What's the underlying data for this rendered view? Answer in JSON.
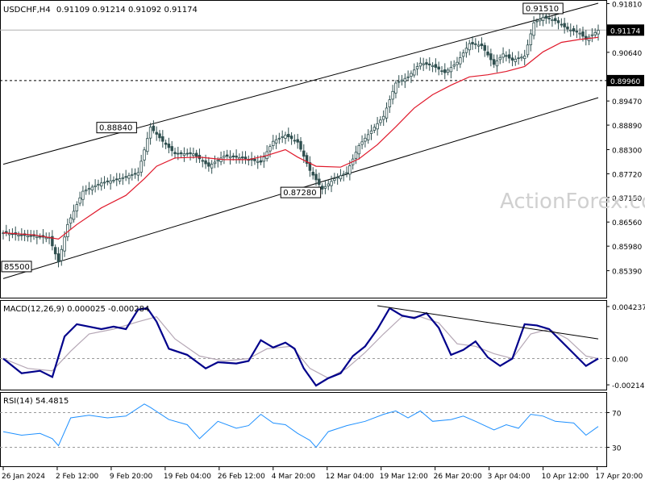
{
  "header": {
    "symbol": "USDCHF,H4",
    "ohlc": "0.91109 0.91214 0.91092 0.91174"
  },
  "watermark": "ActionForex.com",
  "colors": {
    "candle": "#2f4f4f",
    "sma": "#e0192b",
    "macd": "#00008b",
    "signal": "#b5a7b5",
    "rsi": "#1e90ff",
    "trendline": "#000000",
    "grid": "#c8c8c8",
    "badge_bg": "#000000",
    "badge_text": "#ffffff"
  },
  "chart_data": [
    {
      "type": "candlestick",
      "panel": "price",
      "symbol": "USDCHF",
      "timeframe": "H4",
      "ylim": [
        0.848,
        0.9182
      ],
      "yticks": [
        "0.91810",
        "0.91174",
        "0.90640",
        "0.89960",
        "0.89470",
        "0.88890",
        "0.88300",
        "0.87720",
        "0.87150",
        "0.86560",
        "0.85980",
        "0.85390"
      ],
      "xticks": [
        "26 Jan 2024",
        "2 Feb 12:00",
        "9 Feb 20:00",
        "19 Feb 04:00",
        "26 Feb 12:00",
        "4 Mar 20:00",
        "12 Mar 04:00",
        "19 Mar 12:00",
        "26 Mar 20:00",
        "3 Apr 04:00",
        "10 Apr 12:00",
        "17 Apr 20:00"
      ],
      "close_path": [
        [
          0,
          0.863
        ],
        [
          5,
          0.8625
        ],
        [
          10,
          0.8622
        ],
        [
          15,
          0.8618
        ],
        [
          18,
          0.856
        ],
        [
          21,
          0.865
        ],
        [
          26,
          0.873
        ],
        [
          32,
          0.875
        ],
        [
          38,
          0.876
        ],
        [
          44,
          0.8775
        ],
        [
          48,
          0.8884
        ],
        [
          52,
          0.885
        ],
        [
          56,
          0.882
        ],
        [
          62,
          0.882
        ],
        [
          67,
          0.879
        ],
        [
          72,
          0.8815
        ],
        [
          78,
          0.881
        ],
        [
          84,
          0.88
        ],
        [
          88,
          0.885
        ],
        [
          92,
          0.8865
        ],
        [
          96,
          0.8848
        ],
        [
          100,
          0.878
        ],
        [
          104,
          0.8735
        ],
        [
          108,
          0.876
        ],
        [
          112,
          0.8775
        ],
        [
          116,
          0.884
        ],
        [
          120,
          0.8875
        ],
        [
          124,
          0.891
        ],
        [
          128,
          0.899
        ],
        [
          132,
          0.9005
        ],
        [
          136,
          0.9038
        ],
        [
          140,
          0.9032
        ],
        [
          144,
          0.9015
        ],
        [
          148,
          0.904
        ],
        [
          152,
          0.9085
        ],
        [
          156,
          0.908
        ],
        [
          160,
          0.9035
        ],
        [
          163,
          0.906
        ],
        [
          166,
          0.9045
        ],
        [
          170,
          0.9055
        ],
        [
          173,
          0.9135
        ],
        [
          176,
          0.9148
        ],
        [
          180,
          0.914
        ],
        [
          184,
          0.912
        ],
        [
          188,
          0.911
        ],
        [
          190,
          0.9095
        ],
        [
          194,
          0.9117
        ]
      ],
      "sma_path": [
        [
          0,
          0.863
        ],
        [
          10,
          0.8625
        ],
        [
          18,
          0.8615
        ],
        [
          24,
          0.865
        ],
        [
          32,
          0.869
        ],
        [
          40,
          0.872
        ],
        [
          46,
          0.876
        ],
        [
          50,
          0.879
        ],
        [
          56,
          0.881
        ],
        [
          64,
          0.8812
        ],
        [
          72,
          0.8806
        ],
        [
          80,
          0.8806
        ],
        [
          86,
          0.8816
        ],
        [
          92,
          0.883
        ],
        [
          96,
          0.8812
        ],
        [
          102,
          0.879
        ],
        [
          110,
          0.8788
        ],
        [
          116,
          0.8808
        ],
        [
          122,
          0.8842
        ],
        [
          128,
          0.8885
        ],
        [
          134,
          0.893
        ],
        [
          140,
          0.8962
        ],
        [
          146,
          0.8985
        ],
        [
          152,
          0.9005
        ],
        [
          158,
          0.901
        ],
        [
          164,
          0.9018
        ],
        [
          170,
          0.903
        ],
        [
          176,
          0.9065
        ],
        [
          182,
          0.9088
        ],
        [
          188,
          0.9095
        ],
        [
          194,
          0.91
        ]
      ],
      "channel_upper": [
        [
          0,
          0.8795
        ],
        [
          194,
          0.9182
        ]
      ],
      "channel_lower": [
        [
          0,
          0.852
        ],
        [
          194,
          0.8955
        ]
      ],
      "horizontal_levels": [
        {
          "value": 0.91174,
          "style": "solid"
        },
        {
          "value": 0.8996,
          "style": "dashed"
        }
      ],
      "price_badges": [
        "0.91174",
        "0.89960"
      ],
      "annotations": [
        {
          "label": "0.88840",
          "x": 44,
          "y": 0.8884
        },
        {
          "label": "0.87280",
          "x": 104,
          "y": 0.8728
        },
        {
          "label": "0.91510",
          "x": 176,
          "y": 0.9151
        },
        {
          "label": "85500",
          "x": 18,
          "y": 0.855
        }
      ]
    },
    {
      "type": "line",
      "panel": "macd",
      "title": "MACD(12,26,9) 0.000025 -0.000284",
      "ylim": [
        -0.0024,
        0.0045
      ],
      "yticks": [
        "0.004237",
        "0.00",
        "-0.002142"
      ],
      "zero_line": 0,
      "series": [
        {
          "name": "MACD",
          "values": [
            [
              0,
              -0.0
            ],
            [
              6,
              -0.0012
            ],
            [
              12,
              -0.001
            ],
            [
              16,
              -0.0015
            ],
            [
              20,
              0.0018
            ],
            [
              24,
              0.0028
            ],
            [
              28,
              0.0026
            ],
            [
              32,
              0.0024
            ],
            [
              36,
              0.0026
            ],
            [
              40,
              0.0024
            ],
            [
              44,
              0.004
            ],
            [
              47,
              0.0041
            ],
            [
              50,
              0.003
            ],
            [
              54,
              0.0008
            ],
            [
              60,
              0.0003
            ],
            [
              66,
              -0.0008
            ],
            [
              70,
              -0.0003
            ],
            [
              76,
              -0.0004
            ],
            [
              80,
              -0.0002
            ],
            [
              84,
              0.0015
            ],
            [
              88,
              0.0009
            ],
            [
              92,
              0.0013
            ],
            [
              95,
              0.0008
            ],
            [
              98,
              -0.0008
            ],
            [
              102,
              -0.0022
            ],
            [
              106,
              -0.0016
            ],
            [
              110,
              -0.0012
            ],
            [
              114,
              0.0002
            ],
            [
              118,
              0.001
            ],
            [
              122,
              0.0024
            ],
            [
              126,
              0.0041
            ],
            [
              130,
              0.0035
            ],
            [
              134,
              0.0033
            ],
            [
              138,
              0.0037
            ],
            [
              142,
              0.0025
            ],
            [
              146,
              0.0003
            ],
            [
              150,
              0.0007
            ],
            [
              154,
              0.0014
            ],
            [
              158,
              0.0001
            ],
            [
              162,
              -0.0006
            ],
            [
              166,
              0.0
            ],
            [
              170,
              0.0028
            ],
            [
              174,
              0.0027
            ],
            [
              178,
              0.0024
            ],
            [
              182,
              0.0014
            ],
            [
              186,
              0.0004
            ],
            [
              190,
              -0.0006
            ],
            [
              194,
              0.0
            ]
          ]
        },
        {
          "name": "Signal",
          "values": [
            [
              0,
              0.0
            ],
            [
              8,
              -0.0008
            ],
            [
              16,
              -0.001
            ],
            [
              22,
              0.0006
            ],
            [
              28,
              0.002
            ],
            [
              36,
              0.0024
            ],
            [
              44,
              0.003
            ],
            [
              50,
              0.0034
            ],
            [
              56,
              0.0016
            ],
            [
              64,
              0.0002
            ],
            [
              72,
              -0.0002
            ],
            [
              80,
              0.0
            ],
            [
              86,
              0.0008
            ],
            [
              94,
              0.001
            ],
            [
              100,
              -0.0008
            ],
            [
              106,
              -0.0016
            ],
            [
              112,
              -0.0008
            ],
            [
              118,
              0.0005
            ],
            [
              124,
              0.002
            ],
            [
              130,
              0.0034
            ],
            [
              136,
              0.0034
            ],
            [
              142,
              0.0029
            ],
            [
              148,
              0.0012
            ],
            [
              154,
              0.001
            ],
            [
              160,
              0.0004
            ],
            [
              166,
              0.0
            ],
            [
              172,
              0.002
            ],
            [
              178,
              0.0024
            ],
            [
              184,
              0.0016
            ],
            [
              190,
              0.0002
            ],
            [
              194,
              0.0
            ]
          ]
        }
      ],
      "trendline": [
        [
          122,
          0.0043
        ],
        [
          194,
          0.0016
        ]
      ]
    },
    {
      "type": "line",
      "panel": "rsi",
      "title": "RSI(14) 54.4815",
      "ylim": [
        10,
        90
      ],
      "yticks": [
        "70",
        "30"
      ],
      "levels": [
        70,
        30
      ],
      "series": [
        {
          "name": "RSI",
          "values": [
            [
              0,
              48
            ],
            [
              6,
              44
            ],
            [
              12,
              46
            ],
            [
              16,
              40
            ],
            [
              18,
              32
            ],
            [
              22,
              64
            ],
            [
              28,
              67
            ],
            [
              34,
              64
            ],
            [
              40,
              66
            ],
            [
              46,
              80
            ],
            [
              48,
              76
            ],
            [
              54,
              62
            ],
            [
              60,
              56
            ],
            [
              64,
              40
            ],
            [
              70,
              60
            ],
            [
              76,
              52
            ],
            [
              80,
              55
            ],
            [
              84,
              68
            ],
            [
              88,
              58
            ],
            [
              92,
              56
            ],
            [
              96,
              46
            ],
            [
              100,
              38
            ],
            [
              102,
              30
            ],
            [
              106,
              48
            ],
            [
              112,
              55
            ],
            [
              118,
              60
            ],
            [
              124,
              68
            ],
            [
              128,
              72
            ],
            [
              132,
              64
            ],
            [
              136,
              72
            ],
            [
              140,
              60
            ],
            [
              146,
              62
            ],
            [
              150,
              66
            ],
            [
              154,
              60
            ],
            [
              160,
              50
            ],
            [
              164,
              56
            ],
            [
              168,
              52
            ],
            [
              172,
              68
            ],
            [
              176,
              66
            ],
            [
              180,
              60
            ],
            [
              186,
              58
            ],
            [
              190,
              44
            ],
            [
              194,
              54
            ]
          ]
        }
      ]
    }
  ]
}
